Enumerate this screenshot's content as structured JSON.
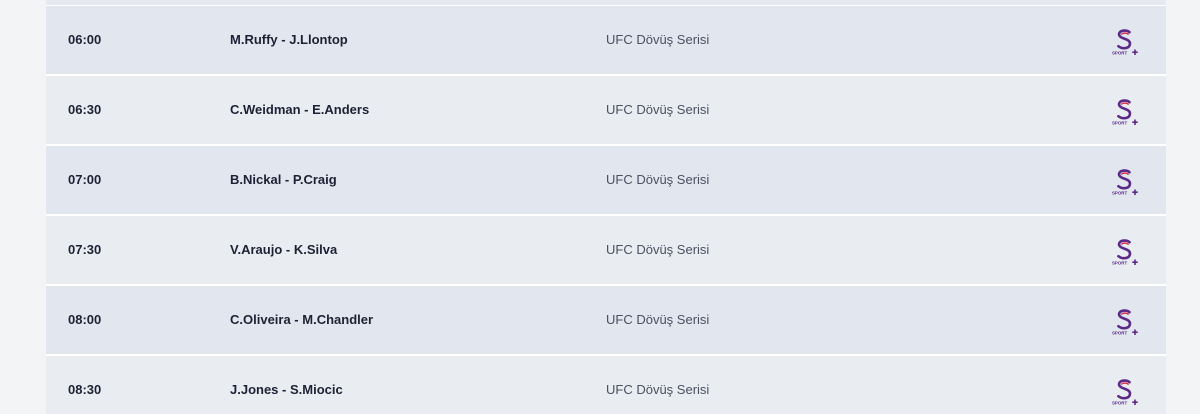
{
  "schedule": {
    "rows": [
      {
        "time": "06:00",
        "match": "M.Ruffy - J.Llontop",
        "event": "UFC Dövüş Serisi",
        "channel_icon": "s-sport-plus-icon"
      },
      {
        "time": "06:30",
        "match": "C.Weidman - E.Anders",
        "event": "UFC Dövüş Serisi",
        "channel_icon": "s-sport-plus-icon"
      },
      {
        "time": "07:00",
        "match": "B.Nickal - P.Craig",
        "event": "UFC Dövüş Serisi",
        "channel_icon": "s-sport-plus-icon"
      },
      {
        "time": "07:30",
        "match": "V.Araujo - K.Silva",
        "event": "UFC Dövüş Serisi",
        "channel_icon": "s-sport-plus-icon"
      },
      {
        "time": "08:00",
        "match": "C.Oliveira - M.Chandler",
        "event": "UFC Dövüş Serisi",
        "channel_icon": "s-sport-plus-icon"
      },
      {
        "time": "08:30",
        "match": "J.Jones - S.Miocic",
        "event": "UFC Dövüş Serisi",
        "channel_icon": "s-sport-plus-icon"
      }
    ]
  },
  "colors": {
    "row_odd": "#e1e6ef",
    "row_even": "#e9edf2",
    "text_primary": "#1c2134",
    "text_secondary": "#4a5060",
    "logo_purple": "#5b2a86",
    "logo_red": "#d7263d"
  }
}
